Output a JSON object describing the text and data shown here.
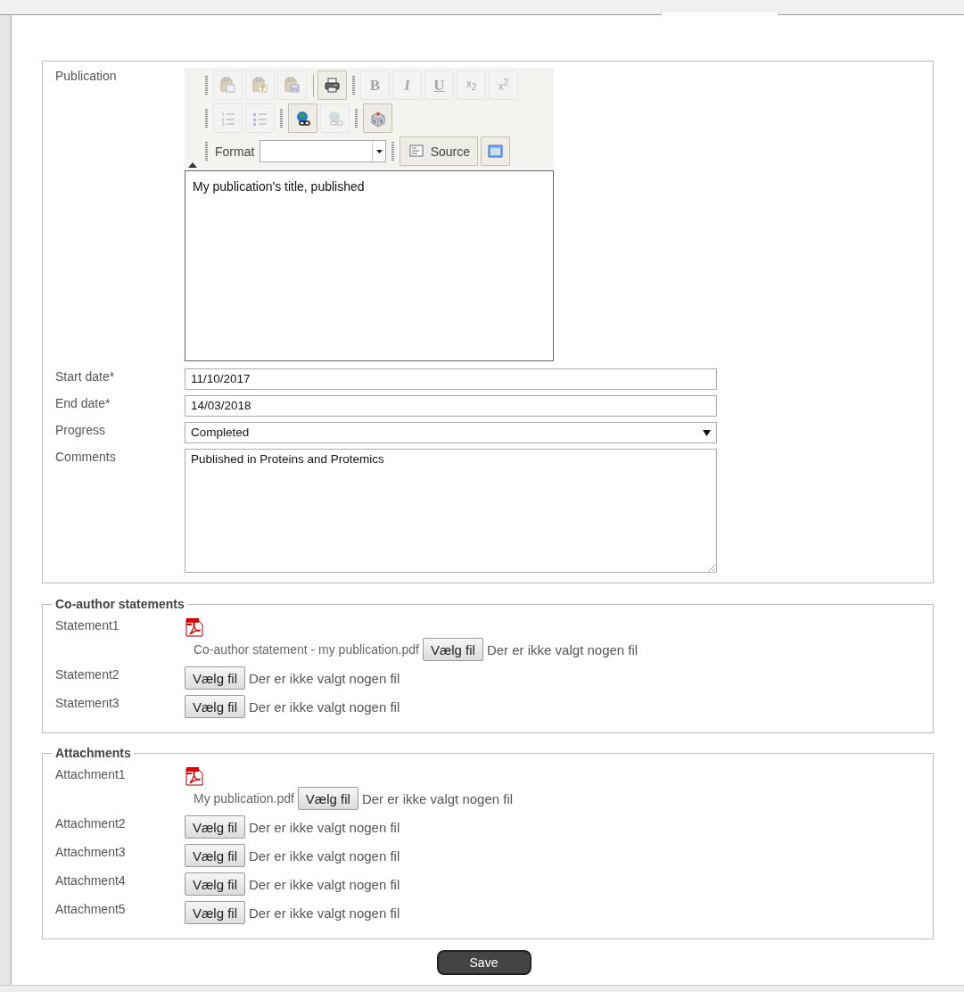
{
  "publication": {
    "label": "Publication",
    "toolbar": [
      [
        {
          "thin_separator": false,
          "tools": [
            {
              "kind": "paste",
              "disabled": true
            },
            {
              "kind": "paste-text",
              "disabled": true
            },
            {
              "kind": "paste-word",
              "disabled": true
            }
          ]
        },
        {
          "thin_separator": true,
          "tools": [
            {
              "kind": "print",
              "disabled": false
            }
          ]
        },
        {
          "thin_separator": false,
          "tools": [
            {
              "kind": "bold",
              "glyph": "B",
              "disabled": true
            },
            {
              "kind": "italic",
              "glyph": "I",
              "disabled": true
            },
            {
              "kind": "underline",
              "glyph": "U",
              "disabled": true
            },
            {
              "kind": "subscript",
              "glyph": "x$_{2}$",
              "disabled": true
            },
            {
              "kind": "superscript",
              "glyph": "x$^{2}$",
              "disabled": true
            }
          ]
        }
      ],
      [
        {
          "thin_separator": false,
          "tools": [
            {
              "kind": "numbered-list",
              "disabled": true
            },
            {
              "kind": "bulleted-list",
              "disabled": true
            }
          ]
        },
        {
          "thin_separator": false,
          "tools": [
            {
              "kind": "link",
              "disabled": false
            },
            {
              "kind": "unlink",
              "disabled": true
            }
          ]
        },
        {
          "thin_separator": false,
          "tools": [
            {
              "kind": "special",
              "disabled": false
            }
          ]
        }
      ],
      [
        {
          "thin_separator": false,
          "tools": [
            {
              "kind": "format",
              "label": "Format"
            }
          ]
        },
        {
          "thin_separator": false,
          "tools": [
            {
              "kind": "source",
              "label": "Source",
              "disabled": false
            },
            {
              "kind": "maximize",
              "disabled": false
            }
          ]
        }
      ]
    ],
    "content": "My publication's title, published"
  },
  "fields": [
    {
      "kind": "text",
      "label": "Start date*",
      "value": "11/10/2017"
    },
    {
      "kind": "text",
      "label": "End date*",
      "value": "14/03/2018"
    },
    {
      "kind": "select",
      "label": "Progress",
      "value": "Completed"
    },
    {
      "kind": "textarea",
      "label": "Comments",
      "value": "Published in Proteins and Protemics"
    }
  ],
  "sections": [
    {
      "legend": "Co-author statements",
      "rows": [
        {
          "label": "Statement1",
          "existing_file": "Co-author statement - my publication.pdf",
          "button": "Vælg fil",
          "status": "Der er ikke valgt nogen fil"
        },
        {
          "label": "Statement2",
          "button": "Vælg fil",
          "status": "Der er ikke valgt nogen fil"
        },
        {
          "label": "Statement3",
          "button": "Vælg fil",
          "status": "Der er ikke valgt nogen fil"
        }
      ]
    },
    {
      "legend": "Attachments",
      "rows": [
        {
          "label": "Attachment1",
          "existing_file": "My publication.pdf",
          "button": "Vælg fil",
          "status": "Der er ikke valgt nogen fil"
        },
        {
          "label": "Attachment2",
          "button": "Vælg fil",
          "status": "Der er ikke valgt nogen fil"
        },
        {
          "label": "Attachment3",
          "button": "Vælg fil",
          "status": "Der er ikke valgt nogen fil"
        },
        {
          "label": "Attachment4",
          "button": "Vælg fil",
          "status": "Der er ikke valgt nogen fil"
        },
        {
          "label": "Attachment5",
          "button": "Vælg fil",
          "status": "Der er ikke valgt nogen fil"
        }
      ]
    }
  ],
  "save_button": "Save"
}
